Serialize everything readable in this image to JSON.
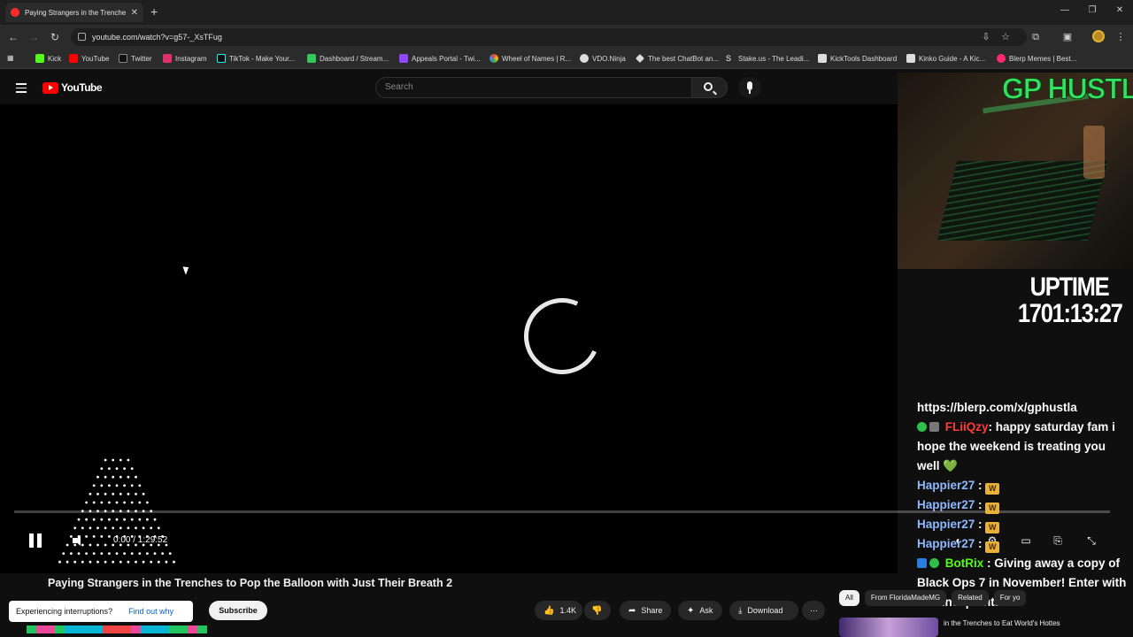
{
  "browser": {
    "tab_title": "Paying Strangers in the Trenche",
    "tab_close": "✕",
    "new_tab": "+",
    "url": "youtube.com/watch?v=g57-_XsTFug",
    "window_controls": {
      "minimize": "—",
      "restore": "❐",
      "close": "✕"
    }
  },
  "bookmarks": [
    {
      "label": "Kick",
      "color": "#53fc18"
    },
    {
      "label": "YouTube",
      "color": "#ff0000"
    },
    {
      "label": "Twitter",
      "color": "#ffffff"
    },
    {
      "label": "Instagram",
      "color": "#e1306c"
    },
    {
      "label": "TikTok - Make Your...",
      "color": "#000000"
    },
    {
      "label": "Dashboard / Stream...",
      "color": "#34c759"
    },
    {
      "label": "Appeals Portal - Twi...",
      "color": "#9146ff"
    },
    {
      "label": "Wheel of Names | R...",
      "color": "#4285f4"
    },
    {
      "label": "VDO.Ninja",
      "color": "#ffffff"
    },
    {
      "label": "The best ChatBot an...",
      "color": "#ffffff"
    },
    {
      "label": "Stake.us - The Leadi...",
      "color": "#ffffff"
    },
    {
      "label": "KickTools Dashboard",
      "color": "#ffffff"
    },
    {
      "label": "Kinko Guide - A Kic...",
      "color": "#ffffff"
    },
    {
      "label": "Blerp Memes | Best...",
      "color": "#ff2a6d"
    }
  ],
  "youtube": {
    "logo_text": "YouTube",
    "search_placeholder": "Search"
  },
  "player": {
    "time_display": "0:00 / 1:29:52",
    "progress": 0.0,
    "state": "loading"
  },
  "overlay": {
    "channel_label": "GP HUSTLA",
    "uptime_label": "UPTIME",
    "uptime_value": "1701:13:27",
    "blerp_link": "https://blerp.com/x/gphustla"
  },
  "chat": [
    {
      "user": "FLiiQzy",
      "user_color": "#ff3b3b",
      "text": ": happy saturday fam i",
      "badges": [
        "verified",
        "mod"
      ]
    },
    {
      "user": "",
      "user_color": "#ffffff",
      "text": "hope the weekend is treating you"
    },
    {
      "user": "",
      "user_color": "#ffffff",
      "text": "well 💚"
    },
    {
      "user": "Happier27",
      "user_color": "#8fb8ff",
      "text": " : ",
      "badge": "W"
    },
    {
      "user": "Happier27",
      "user_color": "#8fb8ff",
      "text": " : ",
      "badge": "W"
    },
    {
      "user": "Happier27",
      "user_color": "#8fb8ff",
      "text": " : ",
      "badge": "W"
    },
    {
      "user": "Happier27",
      "user_color": "#8fb8ff",
      "text": " : ",
      "badge": "W"
    },
    {
      "user": "BotRix",
      "user_color": "#53fc18",
      "text": " : Giving away a copy of",
      "badges": [
        "bot",
        "verified"
      ]
    },
    {
      "user": "",
      "user_color": "#ffffff",
      "text": "Black Ops 7 in November! Enter with"
    },
    {
      "user": "",
      "user_color": "#ffffff",
      "text": "channel points!"
    }
  ],
  "video": {
    "title": "Paying Strangers in the Trenches to Pop the Balloon with Just Their Breath 2",
    "interrupt_text": "Experiencing interruptions?",
    "interrupt_link": "Find out why",
    "subscribe_label": "Subscribe",
    "like_count": "1.4K",
    "share_label": "Share",
    "ask_label": "Ask",
    "download_label": "Download",
    "more_label": "⋯"
  },
  "related": {
    "chips": [
      "All",
      "From FloridaMadeMG",
      "Related",
      "For yo"
    ],
    "active_chip": "All",
    "first_title": "in the Trenches to Eat World's Hottes"
  }
}
